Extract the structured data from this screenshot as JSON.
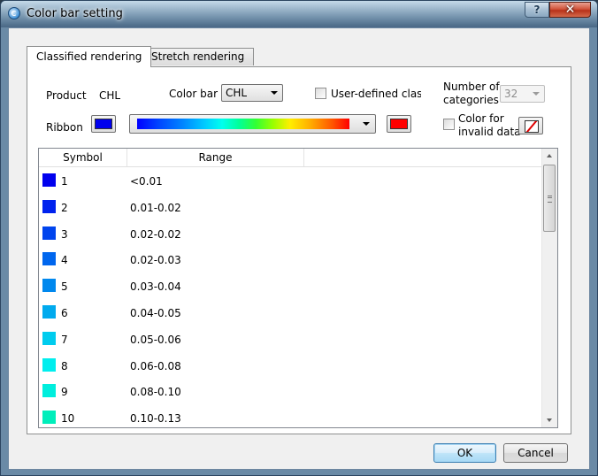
{
  "window": {
    "title": "Color bar setting",
    "help_glyph": "?",
    "close_glyph": "✕"
  },
  "tabs": [
    {
      "label": "Classified rendering",
      "active": true
    },
    {
      "label": "Stretch rendering",
      "active": false
    }
  ],
  "form": {
    "product_label": "Product",
    "product_value": "CHL",
    "colorbar_label": "Color bar",
    "colorbar_value": "CHL",
    "user_defined_label": "User-defined classi",
    "num_categories_label_1": "Number of",
    "num_categories_label_2": "categories",
    "num_categories_value": "32",
    "ribbon_label": "Ribbon",
    "ribbon_start_color": "#0000ee",
    "ribbon_end_color": "#ff0000",
    "invalid_label_1": "Color for",
    "invalid_label_2": "invalid data"
  },
  "table": {
    "columns": [
      "Symbol",
      "Range"
    ],
    "rows": [
      {
        "num": "1",
        "range": "<0.01",
        "color": "#0000ee"
      },
      {
        "num": "2",
        "range": "0.01-0.02",
        "color": "#0022ee"
      },
      {
        "num": "3",
        "range": "0.02-0.02",
        "color": "#0044ee"
      },
      {
        "num": "4",
        "range": "0.02-0.03",
        "color": "#0066ee"
      },
      {
        "num": "5",
        "range": "0.03-0.04",
        "color": "#0088ee"
      },
      {
        "num": "6",
        "range": "0.04-0.05",
        "color": "#00aaee"
      },
      {
        "num": "7",
        "range": "0.05-0.06",
        "color": "#00ccee"
      },
      {
        "num": "8",
        "range": "0.06-0.08",
        "color": "#00eeee"
      },
      {
        "num": "9",
        "range": "0.08-0.10",
        "color": "#00eedd"
      },
      {
        "num": "10",
        "range": "0.10-0.13",
        "color": "#00eebb"
      }
    ]
  },
  "buttons": {
    "ok": "OK",
    "cancel": "Cancel"
  }
}
